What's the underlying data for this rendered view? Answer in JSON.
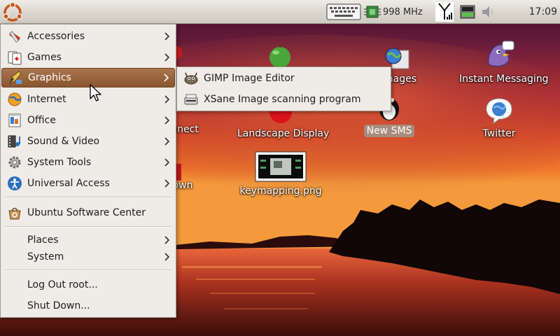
{
  "panel": {
    "cpu_frequency": "998 MHz",
    "clock": "17:09"
  },
  "desktop_icons": [
    {
      "label": "Instant Messaging",
      "icon": "pidgin-bird-icon"
    },
    {
      "label": "Twitter",
      "icon": "chat-globe-icon"
    },
    {
      "label": "Landscape Display",
      "icon": "red-ball-icon"
    },
    {
      "label": "New SMS",
      "icon": "tux-penguin-icon"
    },
    {
      "label": "keymapping.png",
      "icon": "image-thumbnail-icon"
    },
    {
      "label": "mages",
      "icon": "globe-doc-icon"
    },
    {
      "label": "nnect",
      "icon": "connect-icon"
    },
    {
      "label": "own",
      "icon": "shutdown-icon"
    }
  ],
  "menu": {
    "items": [
      {
        "label": "Accessories",
        "icon": "accessories-icon",
        "submenu": true
      },
      {
        "label": "Games",
        "icon": "cards-icon",
        "submenu": true
      },
      {
        "label": "Graphics",
        "icon": "graphics-icon",
        "submenu": true,
        "active": true
      },
      {
        "label": "Internet",
        "icon": "internet-globe-icon",
        "submenu": true
      },
      {
        "label": "Office",
        "icon": "office-icon",
        "submenu": true
      },
      {
        "label": "Sound & Video",
        "icon": "sound-video-icon",
        "submenu": true
      },
      {
        "label": "System Tools",
        "icon": "gear-icon",
        "submenu": true
      },
      {
        "label": "Universal Access",
        "icon": "accessibility-icon",
        "submenu": true
      },
      {
        "label": "Ubuntu Software Center",
        "icon": "software-center-icon",
        "submenu": false
      },
      {
        "label": "Places",
        "submenu": true
      },
      {
        "label": "System",
        "submenu": true
      },
      {
        "label": "Log Out root...",
        "submenu": false
      },
      {
        "label": "Shut Down...",
        "submenu": false
      }
    ]
  },
  "graphics_submenu": {
    "items": [
      {
        "label": "GIMP Image Editor",
        "icon": "gimp-icon"
      },
      {
        "label": "XSane Image scanning program",
        "icon": "scanner-icon"
      }
    ]
  },
  "colors": {
    "menu_highlight": "#8a552f",
    "panel_bg": "#dcd8d0",
    "menu_bg": "#efebe7"
  }
}
